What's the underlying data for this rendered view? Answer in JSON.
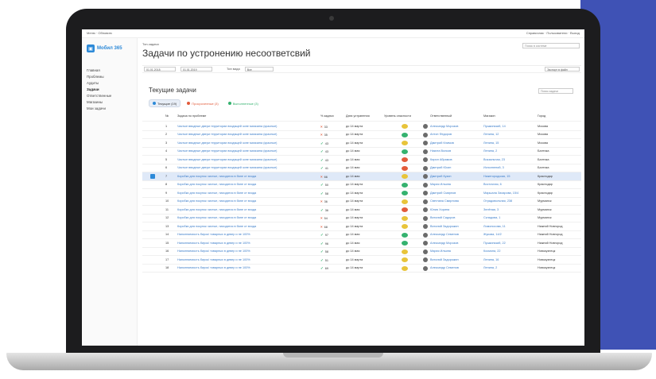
{
  "app": {
    "logo_text": "Мобил 365",
    "crumb": "Топ-задачи",
    "title": "Задачи по устронению несоответсвий",
    "header_search_placeholder": "Поиск в системе",
    "topbar_left": "Меню · Обновить",
    "topbar_right": "Справочник · Пользователи · Выход"
  },
  "sidebar": {
    "items": [
      {
        "label": "Главная"
      },
      {
        "label": "Проблемы"
      },
      {
        "label": "Аудиты"
      },
      {
        "label": "Задачи"
      },
      {
        "label": "Ответственные"
      },
      {
        "label": "Магазины"
      },
      {
        "label": "Мои задачи"
      }
    ]
  },
  "filters": {
    "date_from": "01.01.2018",
    "date_to": "01.01.2019",
    "type_label": "Тип вида",
    "type_value": "Все",
    "right_button": "Экспорт в файл"
  },
  "section": {
    "title": "Текущие задачи",
    "search_placeholder": "Поиск задачи",
    "tabs": [
      {
        "label": "Текущие (19)",
        "color": "#2d8ad8"
      },
      {
        "label": "Просроченные (3)",
        "color": "#e25b3b"
      },
      {
        "label": "Выполненные (3)",
        "color": "#35b26f"
      }
    ]
  },
  "table": {
    "headers": [
      "№",
      "Задача по проблеме",
      "% задачи",
      "Дата устранения",
      "Уровень опасности",
      "Ответственный",
      "Магазин",
      "Город"
    ],
    "rows": [
      {
        "num": "1",
        "name": "Частые вводные двери территории входящей зоне магазина (красные)",
        "mark": "×",
        "pct": "33",
        "date": "до 14 марта",
        "level": "#e8c43a",
        "resp": "Александр Морозов",
        "shop": "Пушкинский, 14",
        "city": "Москва"
      },
      {
        "num": "2",
        "name": "Частые вводные двери территории входящей зоне магазина (красные)",
        "mark": "×",
        "pct": "35",
        "date": "до 14 марта",
        "level": "#35b26f",
        "resp": "Антон Федоров",
        "shop": "Ленина, 12",
        "city": "Москва"
      },
      {
        "num": "3",
        "name": "Частые вводные двери территории входящей зоне магазина (красные)",
        "mark": "✓",
        "pct": "43",
        "date": "до 14 марта",
        "level": "#e8c43a",
        "resp": "Дмитрий Климов",
        "shop": "Ленина, 15",
        "city": "Москва"
      },
      {
        "num": "4",
        "name": "Частые вводные двери территории входящей зоне магазина (красные)",
        "mark": "✓",
        "pct": "43",
        "date": "до 14 мая",
        "level": "#35b26f",
        "resp": "Никита Волков",
        "shop": "Ленина, 2",
        "city": "Балтика"
      },
      {
        "num": "5",
        "name": "Частые вводные двери территории входящей зоне магазина (красные)",
        "mark": "✓",
        "pct": "43",
        "date": "до 14 мая",
        "level": "#e25b3b",
        "resp": "Кирил Абрамов",
        "shop": "Вокзальная, 23",
        "city": "Балтика"
      },
      {
        "num": "6",
        "name": "Частые вводные двери территории входящей зоне магазина (красные)",
        "mark": "✓",
        "pct": "41",
        "date": "до 14 мая",
        "level": "#e25b3b",
        "resp": "Дмитрий Юсин",
        "shop": "Исполнений, 3",
        "city": "Балтика"
      },
      {
        "num": "7",
        "name": "Коробки для покупок чистые, находятся в бане от входа",
        "mark": "×",
        "pct": "66",
        "date": "до 14 мая",
        "level": "#e8c43a",
        "resp": "Дмитрий Кузин",
        "shop": "Нижегородская, 15",
        "city": "Краснодар",
        "selected": true
      },
      {
        "num": "8",
        "name": "Коробки для покупок чистые, находятся в бане от входа",
        "mark": "✓",
        "pct": "50",
        "date": "до 14 марта",
        "level": "#35b26f",
        "resp": "Мария Ильина",
        "shop": "Восточная, 6",
        "city": "Краснодар"
      },
      {
        "num": "9",
        "name": "Коробки для покупок чистые, находятся в бане от входа",
        "mark": "✓",
        "pct": "58",
        "date": "до 14 марта",
        "level": "#35b26f",
        "resp": "Дмитрий Смирнов",
        "shop": "Маршала Захарова, 15/4",
        "city": "Краснодар"
      },
      {
        "num": "10",
        "name": "Коробки для покупок чистые, находятся в бане от входа",
        "mark": "×",
        "pct": "36",
        "date": "до 14 марта",
        "level": "#e8c43a",
        "resp": "Светлана Смирнова",
        "shop": "Отрадовольная, 238",
        "city": "Мурманск"
      },
      {
        "num": "11",
        "name": "Коробки для покупок чистые, находятся в бане от входа",
        "mark": "✓",
        "pct": "36",
        "date": "до 14 мая",
        "level": "#e25b3b",
        "resp": "Юлия Хорина",
        "shop": "Зелёная, 3",
        "city": "Мурманск"
      },
      {
        "num": "12",
        "name": "Коробки для покупок чистые, находятся в бане от входа",
        "mark": "×",
        "pct": "54",
        "date": "до 14 марта",
        "level": "#e8c43a",
        "resp": "Виталий Сидоров",
        "shop": "Складова, 1",
        "city": "Мурманск"
      },
      {
        "num": "13",
        "name": "Коробки для покупок чистые, находятся в бане от входа",
        "mark": "×",
        "pct": "68",
        "date": "до 14 марта",
        "level": "#e8c43a",
        "resp": "Виталий Задорожин",
        "shop": "Ломоносова, 11",
        "city": "Нижний Новгород"
      },
      {
        "num": "14",
        "name": "Наполняемость бирок/ товарных в девер и не 100%",
        "mark": "✓",
        "pct": "97",
        "date": "до 14 мая",
        "level": "#35b26f",
        "resp": "Александр Семенов",
        "shop": "Жукова, 14/2",
        "city": "Нижний Новгород"
      },
      {
        "num": "15",
        "name": "Наполняемость бирок/ товарных в девер и не 100%",
        "mark": "✓",
        "pct": "96",
        "date": "до 14 мая",
        "level": "#35b26f",
        "resp": "Александр Морозов",
        "shop": "Пушкинский, 22",
        "city": "Нижний Новгород"
      },
      {
        "num": "16",
        "name": "Наполняемость бирок/ товарных в девер и не 100%",
        "mark": "✓",
        "pct": "58",
        "date": "до 14 мая",
        "level": "#e8c43a",
        "resp": "Мария Ильина",
        "shop": "Космона, 22",
        "city": "Новокузнецк"
      },
      {
        "num": "17",
        "name": "Наполняемость бирок/ товарных в девер и не 100%",
        "mark": "✓",
        "pct": "51",
        "date": "до 14 марта",
        "level": "#e8c43a",
        "resp": "Виталий Задорожин",
        "shop": "Ленина, 16",
        "city": "Новокузнецк"
      },
      {
        "num": "18",
        "name": "Наполняемость бирок/ товарных в девер и не 100%",
        "mark": "✓",
        "pct": "69",
        "date": "до 14 марта",
        "level": "#e8c43a",
        "resp": "Александр Семенов",
        "shop": "Ленина, 2",
        "city": "Новокузнецк"
      }
    ]
  },
  "colors": {
    "accent": "#2d8ad8",
    "side_panel": "#3f52b5",
    "danger": "#e25b3b",
    "ok": "#35b26f",
    "warn": "#e8c43a"
  }
}
